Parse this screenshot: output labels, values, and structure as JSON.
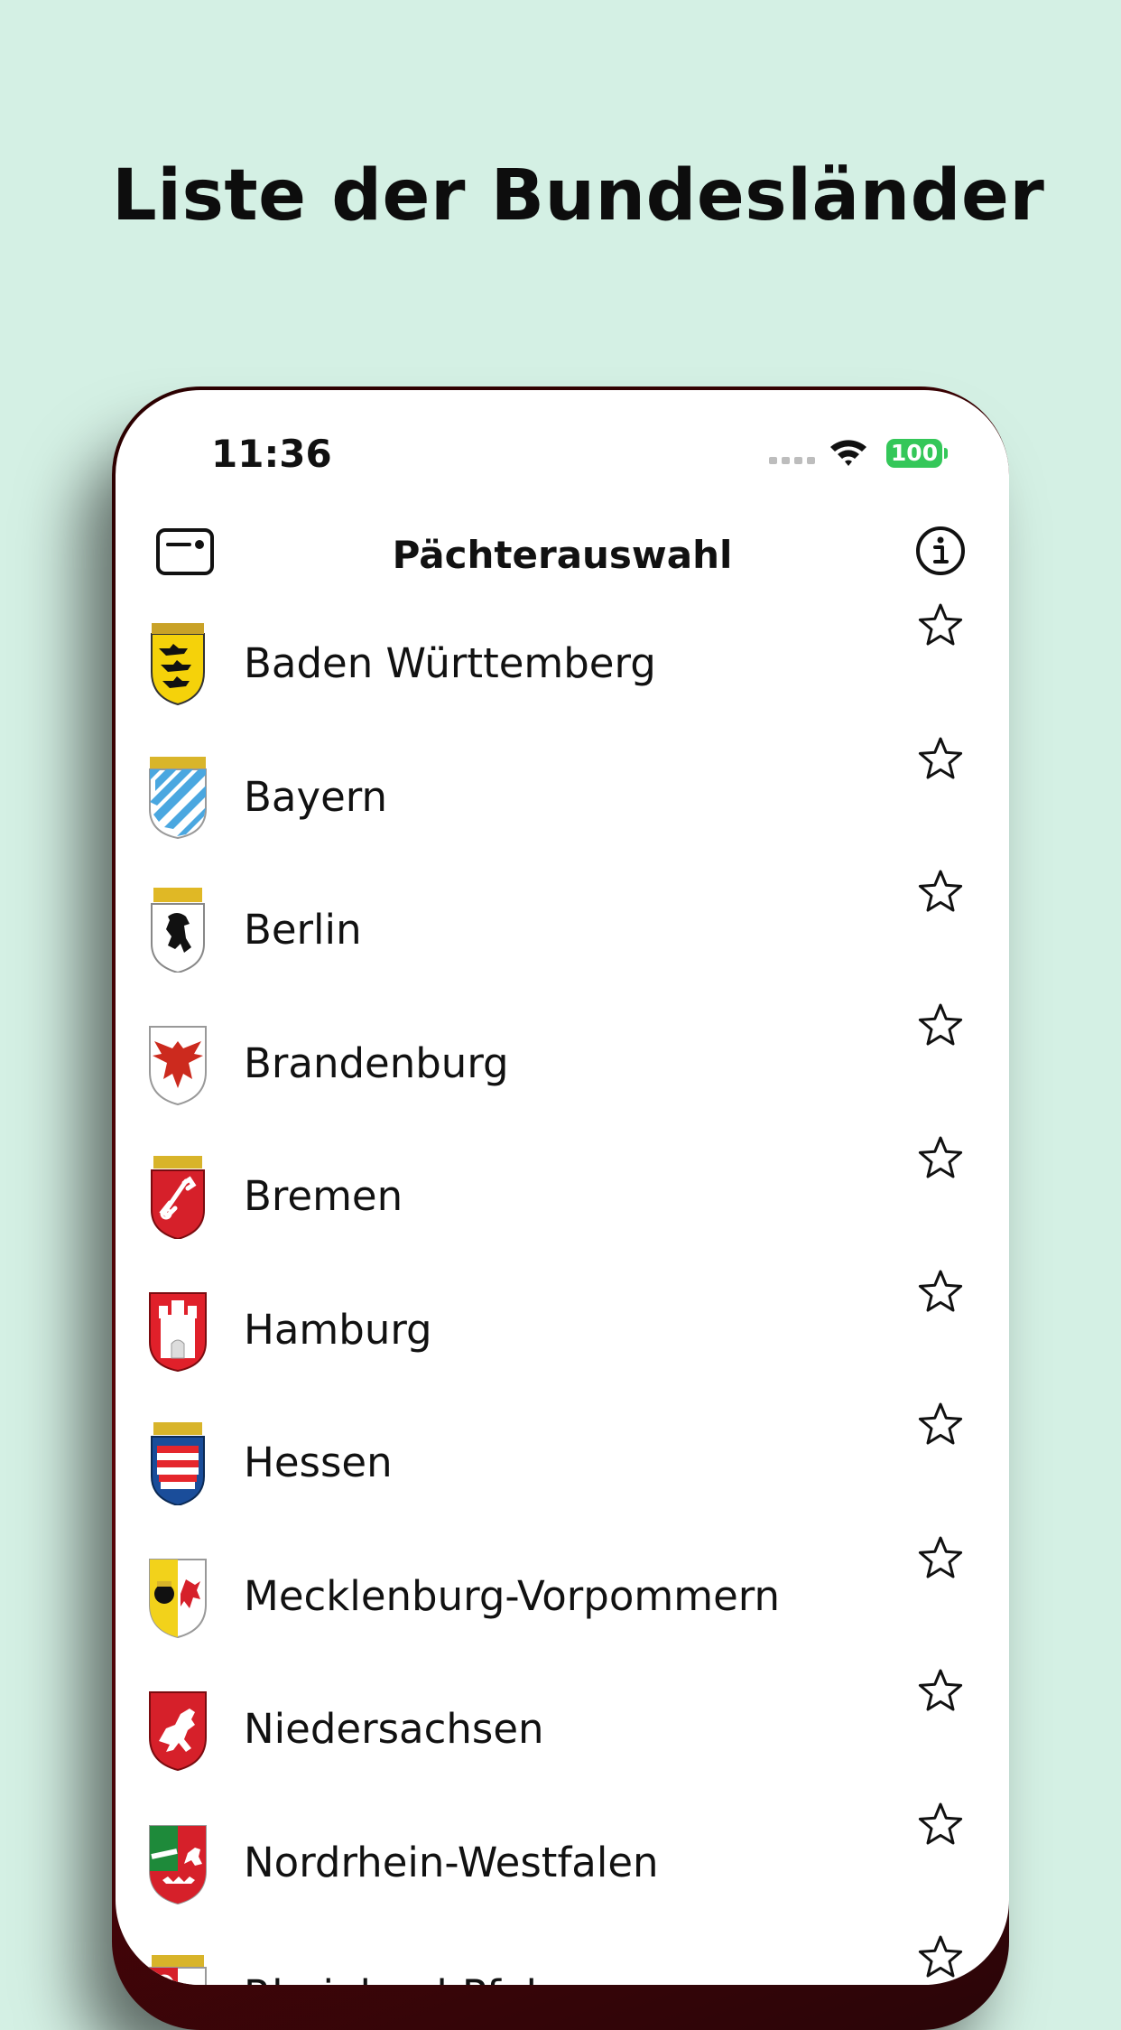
{
  "promo": {
    "title": "Liste der Bundesländer"
  },
  "status_bar": {
    "time": "11:36",
    "battery": "100"
  },
  "nav": {
    "title": "Pächterauswahl"
  },
  "colors": {
    "background": "#d4f0e4",
    "battery": "#34c759",
    "frame": "#5a0408"
  },
  "icons": {
    "left": "card-icon",
    "right": "info-icon",
    "row_action": "star-outline-icon"
  },
  "states": [
    {
      "name": "Baden Württemberg",
      "crest": "baden-wuerttemberg-crest-icon"
    },
    {
      "name": "Bayern",
      "crest": "bayern-crest-icon"
    },
    {
      "name": "Berlin",
      "crest": "berlin-crest-icon"
    },
    {
      "name": "Brandenburg",
      "crest": "brandenburg-crest-icon"
    },
    {
      "name": "Bremen",
      "crest": "bremen-crest-icon"
    },
    {
      "name": "Hamburg",
      "crest": "hamburg-crest-icon"
    },
    {
      "name": "Hessen",
      "crest": "hessen-crest-icon"
    },
    {
      "name": "Mecklenburg-Vorpommern",
      "crest": "mecklenburg-vorpommern-crest-icon"
    },
    {
      "name": "Niedersachsen",
      "crest": "niedersachsen-crest-icon"
    },
    {
      "name": "Nordrhein-Westfalen",
      "crest": "nordrhein-westfalen-crest-icon"
    },
    {
      "name": "Rheinland-Pfalz",
      "crest": "rheinland-pfalz-crest-icon"
    }
  ]
}
